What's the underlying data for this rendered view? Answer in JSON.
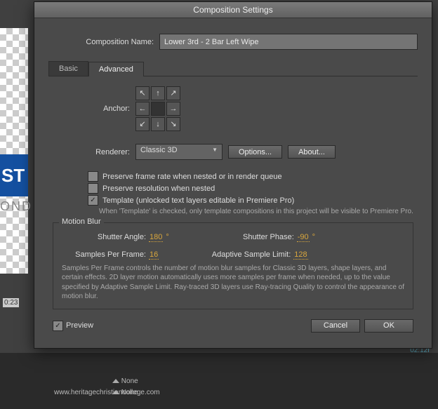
{
  "background": {
    "blue_snippet": "ST",
    "second_text": "OND",
    "timecode": "0:23",
    "tl_time": "02:12f",
    "url": "www.heritagechristiancollege.com",
    "row_none": "None"
  },
  "dialog": {
    "title": "Composition Settings",
    "name_label": "Composition Name:",
    "name_value": "Lower 3rd - 2 Bar Left Wipe",
    "tabs": {
      "basic": "Basic",
      "advanced": "Advanced"
    },
    "anchor_label": "Anchor:",
    "renderer_label": "Renderer:",
    "renderer_value": "Classic 3D",
    "options_btn": "Options...",
    "about_btn": "About...",
    "checks": {
      "preserve_fps": "Preserve frame rate when nested or in render queue",
      "preserve_res": "Preserve resolution when nested",
      "template": "Template (unlocked text layers editable in Premiere Pro)"
    },
    "check_states": {
      "preserve_fps": "",
      "preserve_res": "",
      "template": "✓",
      "preview": "✓"
    },
    "template_help": "When 'Template' is checked, only template compositions in this project will be visible to Premiere Pro.",
    "motion_blur": {
      "legend": "Motion Blur",
      "shutter_angle_label": "Shutter Angle:",
      "shutter_angle_value": "180",
      "degree": " °",
      "shutter_phase_label": "Shutter Phase:",
      "shutter_phase_value": "-90",
      "samples_label": "Samples Per Frame:",
      "samples_value": "16",
      "adaptive_label": "Adaptive Sample Limit:",
      "adaptive_value": "128",
      "help": "Samples Per Frame controls the number of motion blur samples for Classic 3D layers, shape layers, and certain effects. 2D layer motion automatically uses more samples per frame when needed, up to the value specified by Adaptive Sample Limit. Ray-traced 3D layers use Ray-tracing Quality to control the appearance of motion blur."
    },
    "preview_label": "Preview",
    "cancel": "Cancel",
    "ok": "OK"
  }
}
